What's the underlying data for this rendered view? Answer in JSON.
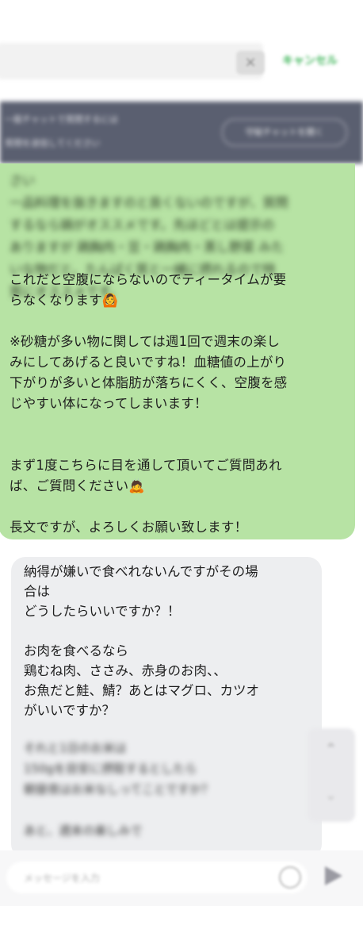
{
  "search": {
    "placeholder": "",
    "clear_icon": "×",
    "cancel_label": "キャンセル"
  },
  "banner": {
    "line1": "一般チャットで質問するには",
    "line2": "質問を送信してください",
    "button_label": "守秘チャットを開く"
  },
  "green_message": {
    "blurred_text": "さい\n一品料理を抜きますのと良くないのですが、質問\nするなら鍋がオススメです。先ほどとは提示の\nありますが 鶏胸肉・豆・鶏胸肉・蒸し野菜 みた\nいな物だと、たんぱく質と一緒に摂れるので特\n質にオススメです。",
    "lines": [
      "これだと空腹にならないのでティータイムが要",
      "らなくなります🙆",
      "",
      "※砂糖が多い物に関しては週1回で週末の楽し",
      "みにしてあげると良いですね！血糖値の上がり",
      "下がりが多いと体脂肪が落ちにくく、空腹を感",
      "じやすい体になってしまいます！",
      "",
      "",
      "まず1度こちらに目を通して頂いてご質問あれ",
      "ば、ご質問ください🙇",
      "",
      "長文ですが、よろしくお願い致します！"
    ]
  },
  "gray_message": {
    "lines": [
      "納得が嫌いで食べれないんですがその場",
      "合は",
      "どうしたらいいですか？！",
      "",
      "お肉を食べるなら",
      "鶏むね肉、ささみ、赤身のお肉、、",
      "お魚だと鮭、鯖？あとはマグロ、カツオ",
      "がいいですか？"
    ],
    "blurred_text": "それと1日のお米は\n150gを目安に摂取するとしたら\n朝昼夜はお米なしってことですか？\n\nあと、週末の楽しみで"
  },
  "scroll": {
    "up_icon": "⌃",
    "down_icon": "⌄"
  },
  "composer": {
    "placeholder": "メッセージを入力"
  },
  "colors": {
    "green_bubble": "#b7e3a4",
    "gray_bubble": "#edeef0",
    "accent": "#3fb55a"
  }
}
